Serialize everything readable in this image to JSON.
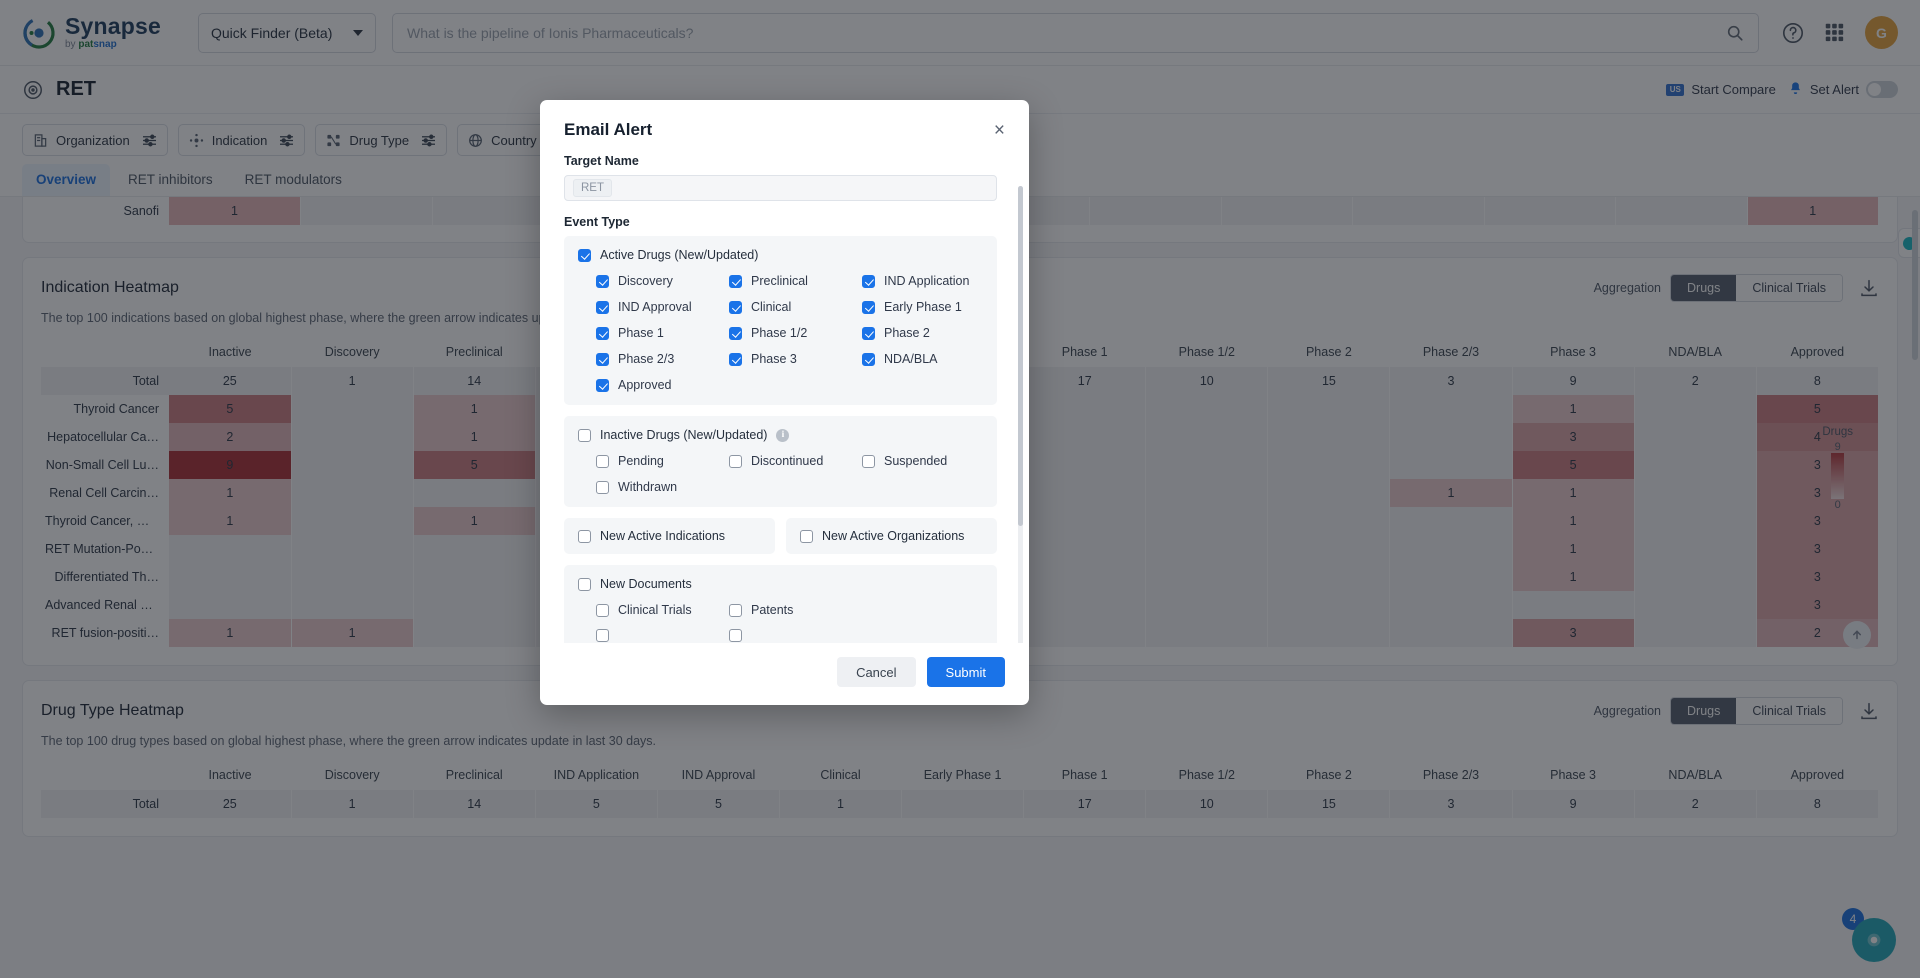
{
  "header": {
    "logo_name": "Synapse",
    "logo_by": "by ",
    "logo_pat": "pat",
    "logo_snap": "snap",
    "finder_label": "Quick Finder (Beta)",
    "search_placeholder": "What is the pipeline of Ionis Pharmaceuticals?",
    "search_value": "",
    "avatar_initial": "G"
  },
  "title_row": {
    "target": "RET",
    "flag": "US",
    "start_compare": "Start Compare",
    "set_alert": "Set Alert"
  },
  "filters": [
    {
      "label": "Organization",
      "icon": "organization-icon"
    },
    {
      "label": "Indication",
      "icon": "indication-icon"
    },
    {
      "label": "Drug Type",
      "icon": "drug-type-icon"
    },
    {
      "label": "Country",
      "icon": "globe-icon"
    }
  ],
  "tabs": [
    {
      "label": "Overview",
      "active": true
    },
    {
      "label": "RET inhibitors",
      "active": false
    },
    {
      "label": "RET modulators",
      "active": false
    }
  ],
  "indication_card": {
    "title": "Indication Heatmap",
    "subtitle": "The top 100 indications based on global highest phase, where the green arrow indicates update in last 30 days.",
    "aggregation_label": "Aggregation",
    "seg_drugs": "Drugs",
    "seg_trials": "Clinical Trials",
    "legend_title": "Drugs",
    "legend_max": "9",
    "legend_min": "0"
  },
  "drugtype_card": {
    "title": "Drug Type Heatmap",
    "subtitle": "The top 100 drug types based on global highest phase, where the green arrow indicates update in last 30 days.",
    "aggregation_label": "Aggregation",
    "seg_drugs": "Drugs",
    "seg_trials": "Clinical Trials"
  },
  "chart_data": {
    "type": "heatmap",
    "title": "Indication Heatmap",
    "columns": [
      "Inactive",
      "Discovery",
      "Preclinical",
      "IND Application",
      "IND Approval",
      "Clinical",
      "Early Phase 1",
      "Phase 1",
      "Phase 1/2",
      "Phase 2",
      "Phase 2/3",
      "Phase 3",
      "NDA/BLA",
      "Approved"
    ],
    "rows": [
      {
        "label": "Total",
        "values": [
          25,
          1,
          14,
          5,
          5,
          1,
          null,
          17,
          10,
          15,
          3,
          9,
          2,
          8
        ]
      },
      {
        "label": "Thyroid Cancer",
        "values": [
          5,
          null,
          1,
          null,
          null,
          null,
          null,
          null,
          null,
          null,
          null,
          1,
          null,
          5
        ]
      },
      {
        "label": "Hepatocellular Ca…",
        "values": [
          2,
          null,
          1,
          null,
          null,
          null,
          null,
          null,
          null,
          null,
          null,
          3,
          null,
          4
        ]
      },
      {
        "label": "Non-Small Cell Lu…",
        "values": [
          9,
          null,
          5,
          null,
          null,
          null,
          null,
          null,
          null,
          null,
          null,
          5,
          null,
          3
        ]
      },
      {
        "label": "Renal Cell Carcin…",
        "values": [
          1,
          null,
          null,
          null,
          null,
          null,
          null,
          null,
          null,
          null,
          1,
          1,
          null,
          3
        ]
      },
      {
        "label": "Thyroid Cancer, M…",
        "values": [
          1,
          null,
          1,
          null,
          null,
          null,
          null,
          null,
          null,
          null,
          null,
          1,
          null,
          3
        ]
      },
      {
        "label": "RET Mutation-Posi…",
        "values": [
          null,
          null,
          null,
          null,
          null,
          null,
          null,
          null,
          null,
          null,
          null,
          1,
          null,
          3
        ]
      },
      {
        "label": "Differentiated Th…",
        "values": [
          null,
          null,
          null,
          null,
          null,
          null,
          null,
          null,
          null,
          null,
          null,
          1,
          null,
          3
        ]
      },
      {
        "label": "Advanced Renal Ce…",
        "values": [
          null,
          null,
          null,
          null,
          null,
          null,
          null,
          null,
          null,
          null,
          null,
          null,
          null,
          3
        ]
      },
      {
        "label": "RET fusion-positi…",
        "values": [
          1,
          1,
          null,
          null,
          null,
          null,
          null,
          null,
          null,
          null,
          null,
          3,
          null,
          2
        ]
      }
    ],
    "drugtype_total_row": {
      "label": "Total",
      "values": [
        25,
        1,
        14,
        5,
        5,
        1,
        null,
        17,
        10,
        15,
        3,
        9,
        2,
        8
      ]
    },
    "legend": {
      "label": "Drugs",
      "max": 9,
      "min": 0
    },
    "colorscale": [
      "#f3dfe0",
      "#b4353a"
    ]
  },
  "modal": {
    "title": "Email Alert",
    "close": "×",
    "target_name_label": "Target Name",
    "target_name_value": "RET",
    "event_type_label": "Event Type",
    "groups": [
      {
        "name": "active-drugs",
        "header": {
          "label": "Active Drugs (New/Updated)",
          "checked": true,
          "info": false
        },
        "items": [
          {
            "label": "Discovery",
            "checked": true
          },
          {
            "label": "Preclinical",
            "checked": true
          },
          {
            "label": "IND Application",
            "checked": true
          },
          {
            "label": "IND Approval",
            "checked": true
          },
          {
            "label": "Clinical",
            "checked": true
          },
          {
            "label": "Early Phase 1",
            "checked": true
          },
          {
            "label": "Phase 1",
            "checked": true
          },
          {
            "label": "Phase 1/2",
            "checked": true
          },
          {
            "label": "Phase 2",
            "checked": true
          },
          {
            "label": "Phase 2/3",
            "checked": true
          },
          {
            "label": "Phase 3",
            "checked": true
          },
          {
            "label": "NDA/BLA",
            "checked": true
          },
          {
            "label": "Approved",
            "checked": true
          }
        ]
      },
      {
        "name": "inactive-drugs",
        "header": {
          "label": "Inactive Drugs (New/Updated)",
          "checked": false,
          "info": true
        },
        "items": [
          {
            "label": "Pending",
            "checked": false
          },
          {
            "label": "Discontinued",
            "checked": false
          },
          {
            "label": "Suspended",
            "checked": false
          },
          {
            "label": "Withdrawn",
            "checked": false
          }
        ]
      }
    ],
    "standalone": [
      {
        "label": "New Active Indications",
        "checked": false
      },
      {
        "label": "New Active Organizations",
        "checked": false
      }
    ],
    "documents": {
      "header": {
        "label": "New Documents",
        "checked": false
      },
      "items": [
        {
          "label": "Clinical Trials",
          "checked": false
        },
        {
          "label": "Patents",
          "checked": false
        }
      ]
    },
    "cancel": "Cancel",
    "submit": "Submit"
  },
  "fab": {
    "badge": "4"
  },
  "colors": {
    "accent": "#1a73e8",
    "heat_max": "#b4353a",
    "teal": "#1fa7b8"
  }
}
